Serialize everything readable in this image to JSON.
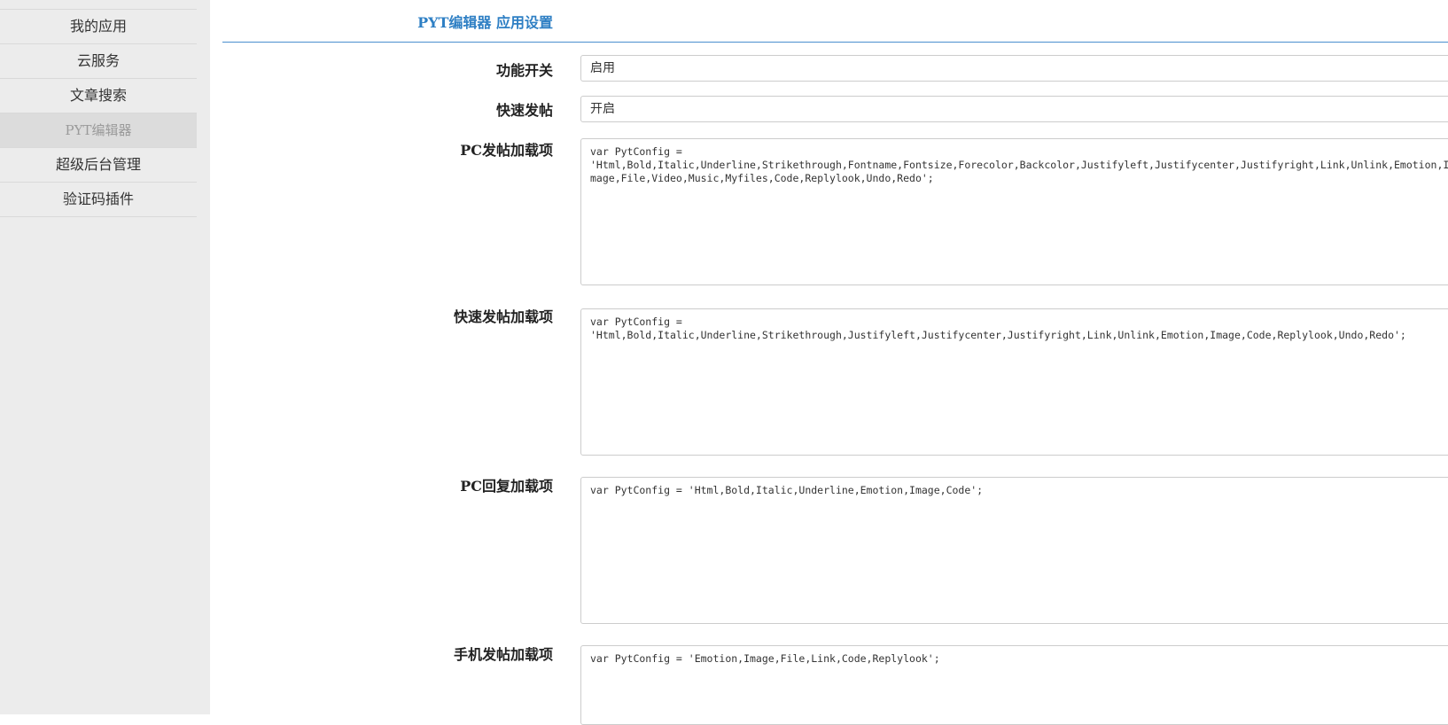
{
  "sidebar": {
    "items": [
      {
        "label": "我的应用"
      },
      {
        "label": "云服务"
      },
      {
        "label": "文章搜索"
      },
      {
        "label": "PYT编辑器"
      },
      {
        "label": "超级后台管理"
      },
      {
        "label": "验证码插件"
      }
    ]
  },
  "header": {
    "title": "PYT编辑器  应用设置"
  },
  "form": {
    "feature_switch": {
      "label": "功能开关",
      "value": "启用"
    },
    "quick_post": {
      "label": "快速发帖",
      "value": "开启"
    },
    "pc_post_config": {
      "label": "PC发帖加载项",
      "value": "var PytConfig =\n'Html,Bold,Italic,Underline,Strikethrough,Fontname,Fontsize,Forecolor,Backcolor,Justifyleft,Justifycenter,Justifyright,Link,Unlink,Emotion,I\nmage,File,Video,Music,Myfiles,Code,Replylook,Undo,Redo';"
    },
    "quick_post_config": {
      "label": "快速发帖加载项",
      "value": "var PytConfig =\n'Html,Bold,Italic,Underline,Strikethrough,Justifyleft,Justifycenter,Justifyright,Link,Unlink,Emotion,Image,Code,Replylook,Undo,Redo';"
    },
    "pc_reply_config": {
      "label": "PC回复加载项",
      "value": "var PytConfig = 'Html,Bold,Italic,Underline,Emotion,Image,Code';"
    },
    "mobile_post_config": {
      "label": "手机发帖加载项",
      "value": "var PytConfig = 'Emotion,Image,File,Link,Code,Replylook';"
    }
  },
  "colors": {
    "accent": "#2e7fc4",
    "sidebar_bg": "#ececec",
    "active_item_bg": "#dcdcdc"
  }
}
